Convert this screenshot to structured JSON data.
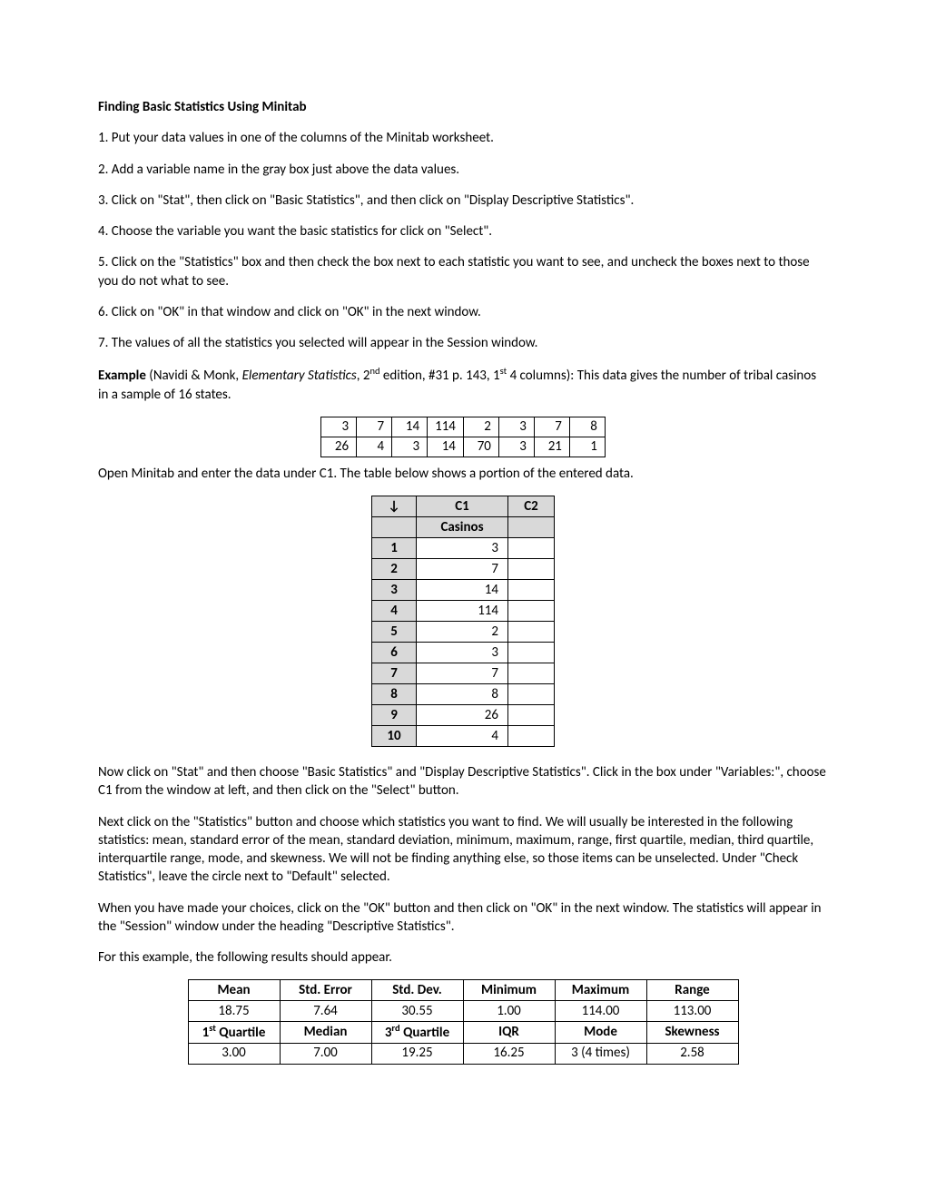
{
  "title": "Finding Basic Statistics Using Minitab",
  "steps": {
    "s1": "1. Put your data values in one of the columns of the Minitab worksheet.",
    "s2": "2. Add a variable name in the gray box just above the data values.",
    "s3": "3. Click on \"Stat\", then click on \"Basic Statistics\", and then click on \"Display Descriptive Statistics\".",
    "s4": "4. Choose the variable you want the basic statistics for click on \"Select\".",
    "s5": "5. Click on the \"Statistics\" box and then check the box next to each statistic you want to see, and uncheck the boxes next to those you do not what to see.",
    "s6": "6. Click on \"OK\" in that window and click on \"OK\" in the next window.",
    "s7": "7. The values of all the statistics you selected will appear in the Session window."
  },
  "example": {
    "label": "Example",
    "pre": " (Navidi & Monk, ",
    "book": "Elementary Statistics",
    "post": ", 2",
    "sup1": "nd",
    "post2": " edition, #31 p. 143, 1",
    "sup2": "st",
    "post3": " 4 columns): This data gives the number of tribal casinos in a sample of 16 states."
  },
  "data_grid": {
    "r0": {
      "c0": "3",
      "c1": "7",
      "c2": "14",
      "c3": "114",
      "c4": "2",
      "c5": "3",
      "c6": "7",
      "c7": "8"
    },
    "r1": {
      "c0": "26",
      "c1": "4",
      "c2": "3",
      "c3": "14",
      "c4": "70",
      "c5": "3",
      "c6": "21",
      "c7": "1"
    }
  },
  "para_open": "Open Minitab and enter the data under C1.  The table below shows a portion of the entered data.",
  "ws": {
    "arrow": "↓",
    "c1": "C1",
    "c2": "C2",
    "varname": "Casinos",
    "rows": {
      "r1": {
        "n": "1",
        "v": "3"
      },
      "r2": {
        "n": "2",
        "v": "7"
      },
      "r3": {
        "n": "3",
        "v": "14"
      },
      "r4": {
        "n": "4",
        "v": "114"
      },
      "r5": {
        "n": "5",
        "v": "2"
      },
      "r6": {
        "n": "6",
        "v": "3"
      },
      "r7": {
        "n": "7",
        "v": "7"
      },
      "r8": {
        "n": "8",
        "v": "8"
      },
      "r9": {
        "n": "9",
        "v": "26"
      },
      "r10": {
        "n": "10",
        "v": "4"
      }
    }
  },
  "para_now": "Now click on \"Stat\" and then choose \"Basic Statistics\" and \"Display Descriptive Statistics\".  Click in the box under \"Variables:\", choose C1 from the window at left, and then click on the \"Select\" button.",
  "para_next": "Next click on the \"Statistics\" button and choose which statistics you want to find.  We will usually be interested in the following statistics: mean, standard error of the mean, standard deviation, minimum, maximum, range, first quartile, median, third quartile, interquartile range, mode, and skewness.  We will not be finding anything else, so those items can be unselected.  Under \"Check Statistics\", leave the circle next to \"Default\" selected.",
  "para_when": "When you have made your choices, click on the \"OK\" button and then click on \"OK\" in the next window.  The statistics will appear in the \"Session\" window under the heading \"Descriptive Statistics\".",
  "para_for": "For this example, the following results should appear.",
  "results": {
    "h": {
      "mean": "Mean",
      "se": "Std. Error",
      "sd": "Std. Dev.",
      "min": "Minimum",
      "max": "Maximum",
      "range": "Range"
    },
    "v": {
      "mean": "18.75",
      "se": "7.64",
      "sd": "30.55",
      "min": "1.00",
      "max": "114.00",
      "range": "113.00"
    },
    "h2_pre": {
      "q1a": "1",
      "q1b": " Quartile",
      "med": "Median",
      "q3a": "3",
      "q3b": " Quartile",
      "iqr": "IQR",
      "mode": "Mode",
      "skew": "Skewness"
    },
    "sup_st": "st",
    "sup_rd": "rd",
    "v2": {
      "q1": "3.00",
      "med": "7.00",
      "q3": "19.25",
      "iqr": "16.25",
      "mode": "3 (4 times)",
      "skew": "2.58"
    }
  }
}
